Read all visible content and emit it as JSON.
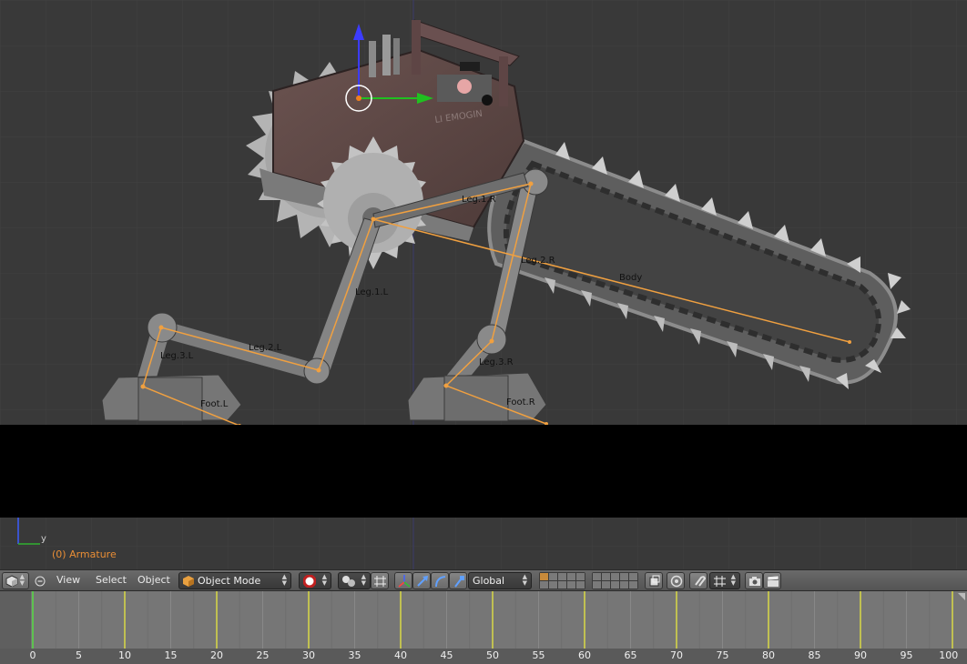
{
  "viewport": {
    "object_label": "(0) Armature",
    "axis_label": "y",
    "bones": [
      {
        "name": "Leg.1.R"
      },
      {
        "name": "Leg.2.R"
      },
      {
        "name": "Body"
      },
      {
        "name": "Leg.1.L"
      },
      {
        "name": "Leg.2.L"
      },
      {
        "name": "Leg.3.L"
      },
      {
        "name": "Leg.3.R"
      },
      {
        "name": "Foot.L"
      },
      {
        "name": "Foot.R"
      }
    ],
    "decal_text": "LI EMOGIN",
    "colors": {
      "background": "#393939",
      "bone": "#f0a040",
      "label": "#e98e36"
    }
  },
  "header": {
    "menus": [
      "View",
      "Select",
      "Object"
    ],
    "mode": "Object Mode",
    "orientation": "Global"
  },
  "timeline": {
    "frame_labels": [
      "0",
      "5",
      "10",
      "15",
      "20",
      "25",
      "30",
      "35",
      "40",
      "45",
      "50",
      "55",
      "60",
      "65",
      "70",
      "75",
      "80",
      "85",
      "90",
      "95",
      "100"
    ]
  }
}
